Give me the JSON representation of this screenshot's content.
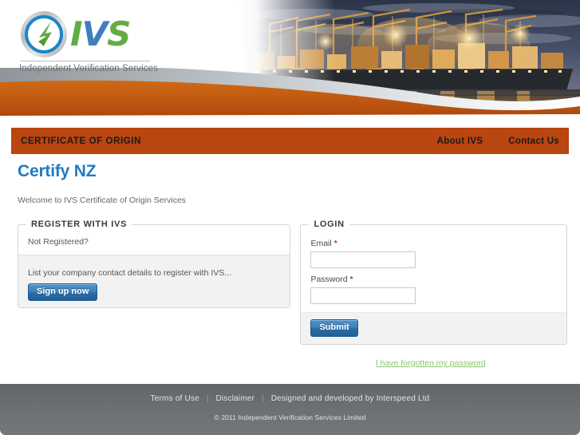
{
  "brand": {
    "logo_icon": "ivs-circle-leaf-logo-icon",
    "word_i": "I",
    "word_v": "V",
    "word_s": "S",
    "tagline": "Independent Verification Services",
    "banner_image": "port-container-ship-cranes-at-dusk-photo"
  },
  "nav": {
    "title": "CERTIFICATE OF ORIGIN",
    "links": [
      {
        "label": "About IVS"
      },
      {
        "label": "Contact Us"
      }
    ],
    "bar_color": "#b94510"
  },
  "main": {
    "page_title": "Certify NZ",
    "page_title_color": "#1d7cc4",
    "welcome": "Welcome to IVS Certificate of Origin Services"
  },
  "register": {
    "legend": "REGISTER WITH IVS",
    "not_registered": "Not Registered?",
    "description": "List your company contact details to register with IVS...",
    "signup_button": "Sign up now"
  },
  "login": {
    "legend": "LOGIN",
    "email_label": "Email",
    "email_value": "",
    "email_placeholder": "",
    "password_label": "Password",
    "password_value": "",
    "password_placeholder": "",
    "required_marker": "*",
    "required_color": "#d1361f",
    "submit_button": "Submit",
    "forgot_link": "I have forgotten my password",
    "forgot_link_color": "#8ec36a"
  },
  "footer": {
    "links": [
      {
        "label": "Terms of Use"
      },
      {
        "label": "Disclaimer"
      },
      {
        "label": "Designed and developed by Interspeed Ltd"
      }
    ],
    "separator": "|",
    "copyright": "© 2011 Independent Verification Services Limited",
    "background_color": "#6d7176"
  }
}
